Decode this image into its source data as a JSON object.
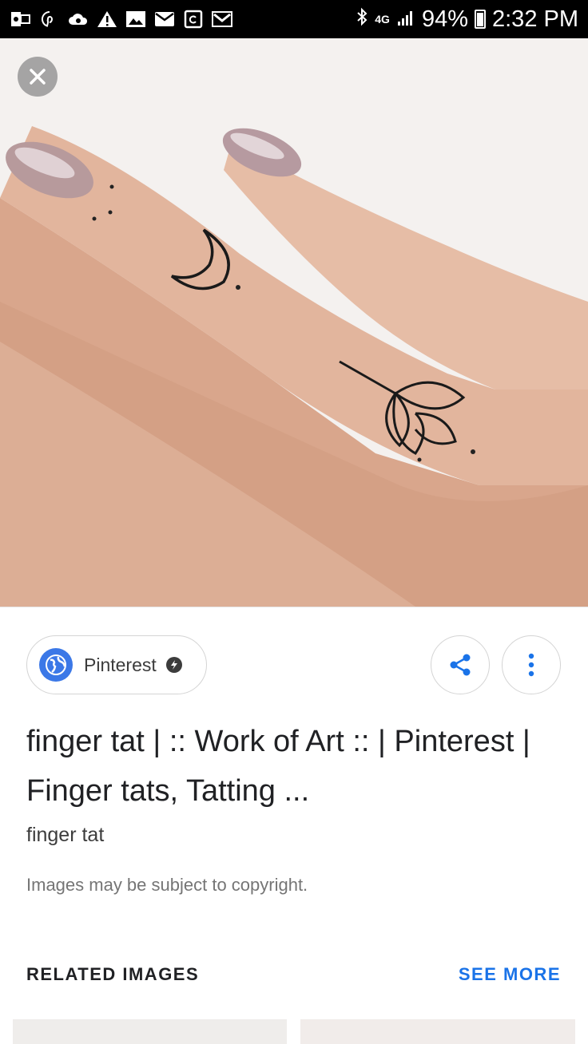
{
  "status_bar": {
    "network": "4G",
    "battery": "94%",
    "time": "2:32 PM",
    "notification_icons": [
      "outlook-icon",
      "pinterest-icon",
      "cloud-icon",
      "warning-icon",
      "gallery-icon",
      "mail-icon",
      "update-icon",
      "gmail-icon"
    ],
    "system_icons": [
      "bluetooth-icon",
      "signal-icon",
      "battery-icon"
    ]
  },
  "viewer": {
    "image_alt": "finger tat",
    "close_icon": "close-icon"
  },
  "result": {
    "source": "Pinterest",
    "title": "finger tat | :: Work of Art :: | Pinterest | Finger tats, Tatting ...",
    "subtitle": "finger tat",
    "copyright_notice": "Images may be subject to copyright."
  },
  "related": {
    "label": "RELATED IMAGES",
    "see_more": "SEE MORE"
  },
  "colors": {
    "accent": "#1a73e8",
    "globe": "#3b78e7",
    "status_bar": "#000000"
  }
}
